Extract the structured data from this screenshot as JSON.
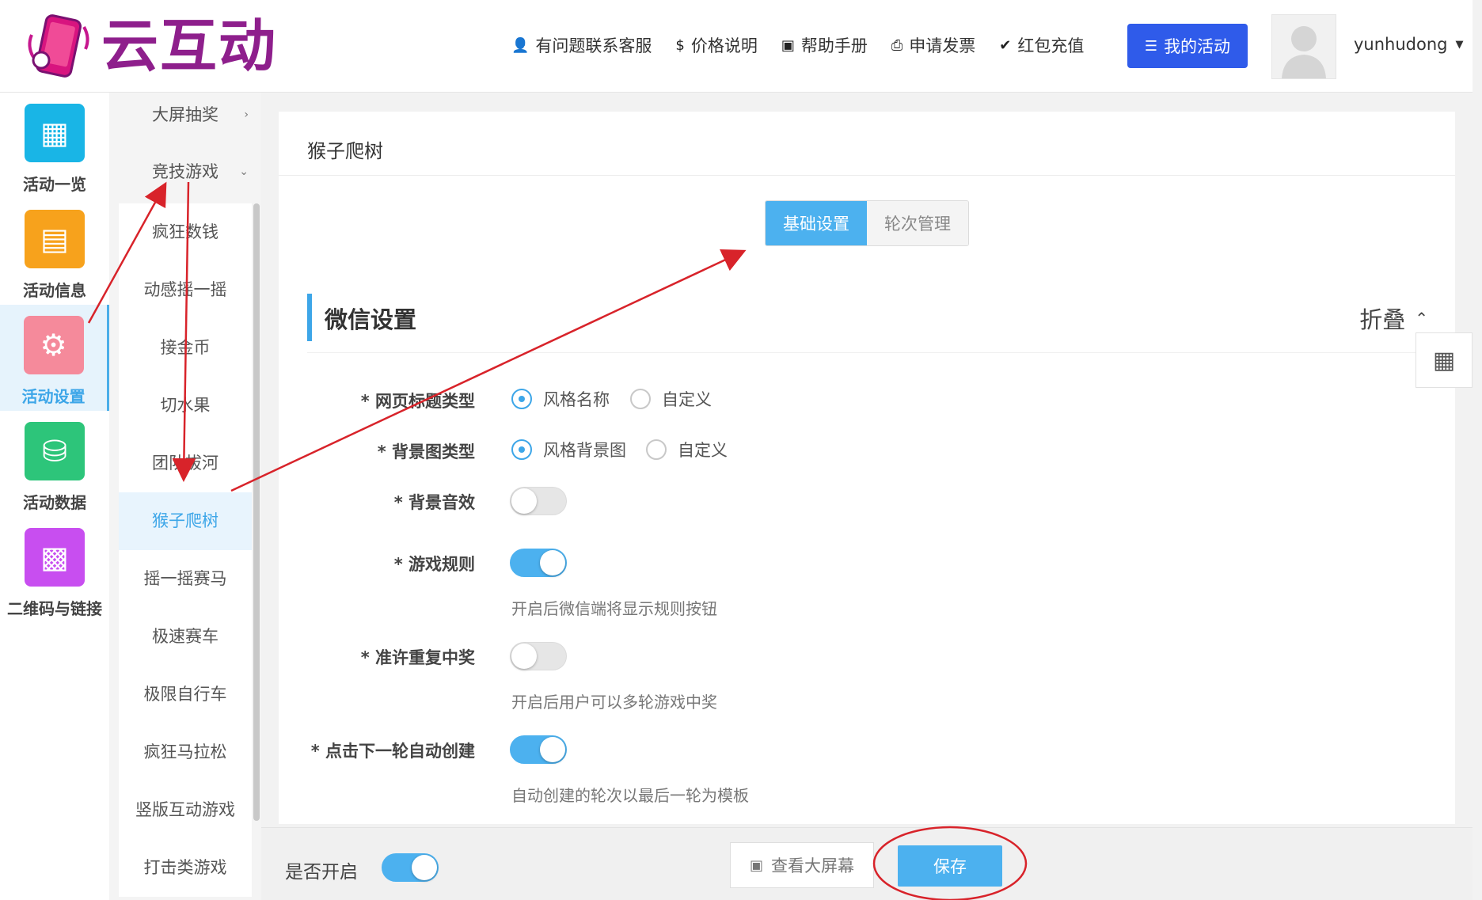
{
  "header": {
    "logo_text": "云互动",
    "nav": [
      {
        "icon": "user-plus-icon",
        "label": "有问题联系客服"
      },
      {
        "icon": "dollar-icon",
        "label": "价格说明"
      },
      {
        "icon": "book-icon",
        "label": "帮助手册"
      },
      {
        "icon": "printer-icon",
        "label": "申请发票"
      },
      {
        "icon": "shield-check-icon",
        "label": "红包充值"
      }
    ],
    "my_activity": "我的活动",
    "username": "yunhudong"
  },
  "rail": [
    {
      "label": "活动一览",
      "icon": "grid-icon",
      "color": "#19b5e6"
    },
    {
      "label": "活动信息",
      "icon": "document-icon",
      "color": "#f7a21c"
    },
    {
      "label": "活动设置",
      "icon": "gear-icon",
      "color": "#f58a9b",
      "active": true
    },
    {
      "label": "活动数据",
      "icon": "database-icon",
      "color": "#2dc57a"
    },
    {
      "label": "二维码与链接",
      "icon": "qrcode-icon",
      "color": "#c84ef0"
    }
  ],
  "submenu": {
    "parents": [
      "大屏抽奖",
      "竞技游戏"
    ],
    "items": [
      "疯狂数钱",
      "动感摇一摇",
      "接金币",
      "切水果",
      "团队拔河",
      "猴子爬树",
      "摇一摇赛马",
      "极速赛车",
      "极限自行车",
      "疯狂马拉松",
      "竖版互动游戏",
      "打击类游戏"
    ],
    "active": "猴子爬树"
  },
  "main": {
    "page_title": "猴子爬树",
    "tabs": [
      "基础设置",
      "轮次管理"
    ],
    "section_title": "微信设置",
    "collapse_label": "折叠",
    "rows": {
      "title_type": {
        "label": "* 网页标题类型",
        "option1": "风格名称",
        "option2": "自定义"
      },
      "bg_type": {
        "label": "* 背景图类型",
        "option1": "风格背景图",
        "option2": "自定义"
      },
      "bg_sound": {
        "label": "* 背景音效"
      },
      "rules": {
        "label": "* 游戏规则",
        "hint": "开启后微信端将显示规则按钮"
      },
      "repeat": {
        "label": "* 准许重复中奖",
        "hint": "开启后用户可以多轮游戏中奖"
      },
      "auto_create": {
        "label": "* 点击下一轮自动创建",
        "hint": "自动创建的轮次以最后一轮为模板"
      }
    }
  },
  "bottom": {
    "enable_label": "是否开启",
    "view_screen": "查看大屏幕",
    "save": "保存"
  }
}
